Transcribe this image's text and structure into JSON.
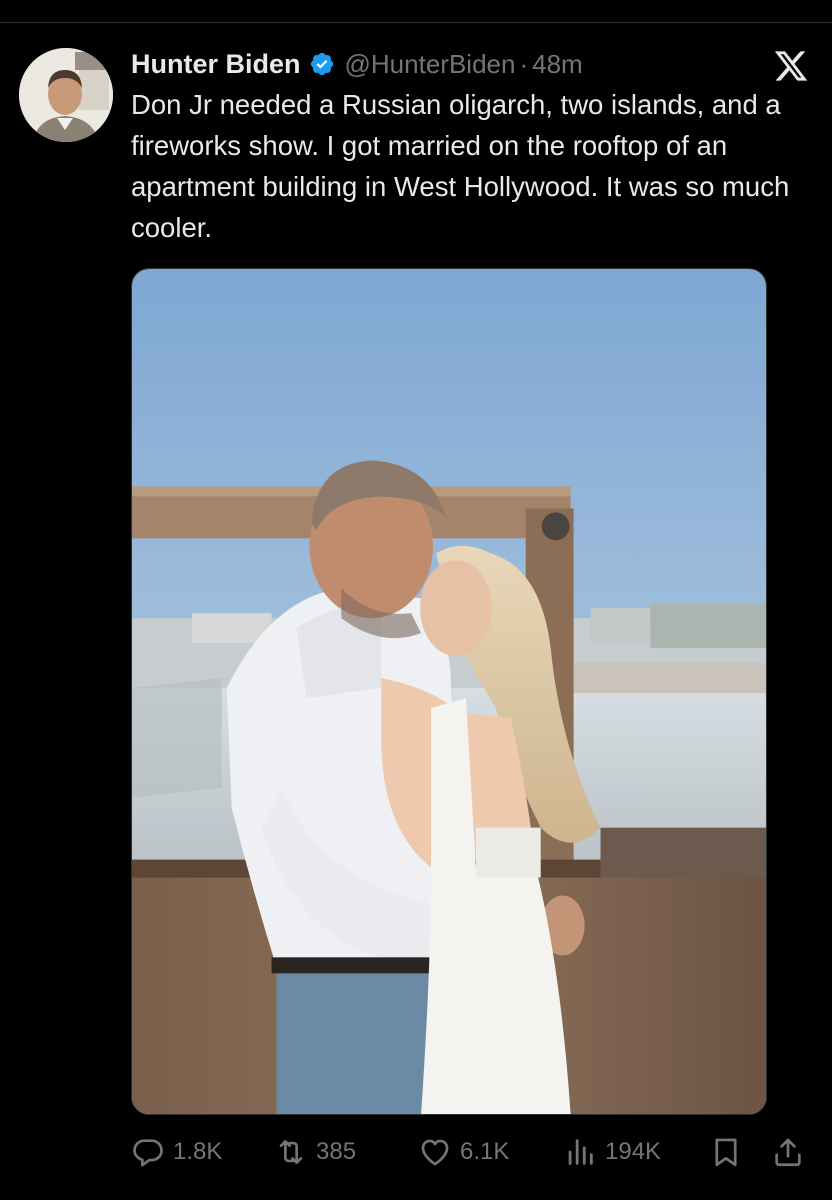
{
  "tweet": {
    "author": {
      "display_name": "Hunter Biden",
      "handle": "@HunterBiden",
      "verified": true,
      "verified_badge_color": "#1d9bf0"
    },
    "separator": "·",
    "timestamp": "48m",
    "text": "Don Jr needed a Russian oligarch, two islands, and a fireworks show. I got married on the rooftop of an apartment building in West Hollywood. It was so much cooler.",
    "media": {
      "type": "photo"
    },
    "stats": {
      "replies": "1.8K",
      "reposts": "385",
      "likes": "6.1K",
      "views": "194K"
    }
  },
  "icons": {
    "platform": "x-logo-icon",
    "reply": "reply-icon",
    "repost": "repost-icon",
    "like": "heart-icon",
    "views": "views-icon",
    "bookmark": "bookmark-icon",
    "share": "share-icon"
  },
  "colors": {
    "background": "#000000",
    "text_primary": "#e7e9ea",
    "text_secondary": "#71767b",
    "divider": "#2f3336"
  }
}
